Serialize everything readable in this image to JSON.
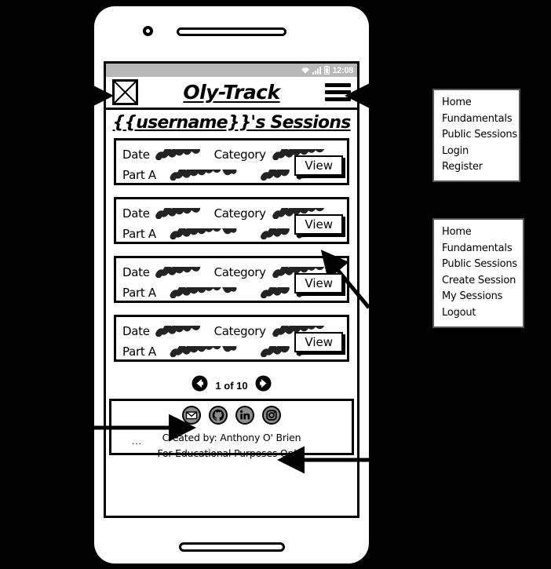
{
  "app": {
    "title": "Oly-Track",
    "page_heading": "{{username}}'s Sessions",
    "logo_alt": "image-placeholder"
  },
  "statusbar": {
    "time": "12:08",
    "icons": [
      "wifi-icon",
      "signal-icon",
      "battery-icon"
    ]
  },
  "appbar": {
    "menu_icon": "hamburger-icon"
  },
  "sessions": {
    "labels": {
      "date": "Date",
      "category": "Category",
      "part_a": "Part A"
    },
    "view_label": "View",
    "items": [
      {
        "date": "scribble",
        "category": "scribble",
        "part_a": "scribble"
      },
      {
        "date": "scribble",
        "category": "scribble",
        "part_a": "scribble"
      },
      {
        "date": "scribble",
        "category": "scribble",
        "part_a": "scribble"
      },
      {
        "date": "scribble",
        "category": "scribble",
        "part_a": "scribble"
      }
    ]
  },
  "pagination": {
    "prev_icon": "arrow-left-circle-icon",
    "next_icon": "arrow-right-circle-icon",
    "label": "1 of 10"
  },
  "footer": {
    "social": [
      "email-icon",
      "github-icon",
      "linkedin-icon",
      "instagram-icon"
    ],
    "ellipsis": "...",
    "line1": "Created by: Anthony O' Brien",
    "line2": "For Educational Purposes Only!"
  },
  "menus": {
    "guest": {
      "items": [
        "Home",
        "Fundamentals",
        "Public Sessions",
        "Login",
        "Register"
      ]
    },
    "user": {
      "items": [
        "Home",
        "Fundamentals",
        "Public Sessions",
        "Create Session",
        "My Sessions",
        "Logout"
      ]
    }
  },
  "colors": {
    "background": "#000000",
    "device": "#ffffff",
    "ink": "#000000",
    "statusbar": "#b8b8b8",
    "icon_fill": "#8c8c8c"
  }
}
